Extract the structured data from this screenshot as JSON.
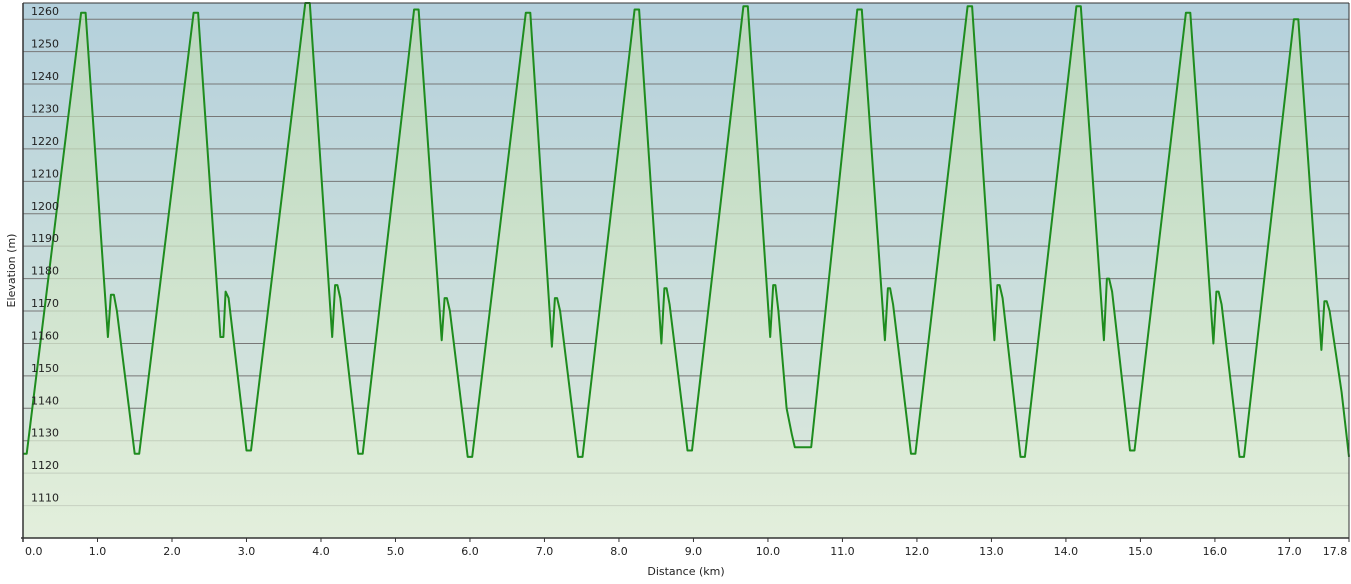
{
  "chart_data": {
    "type": "area",
    "title": "",
    "xlabel": "Distance  (km)",
    "ylabel": "Elevation (m)",
    "xlim": [
      0,
      17.8
    ],
    "ylim": [
      1100,
      1265
    ],
    "x_ticks": [
      "0.0",
      "1.0",
      "2.0",
      "3.0",
      "4.0",
      "5.0",
      "6.0",
      "7.0",
      "8.0",
      "9.0",
      "10.0",
      "11.0",
      "12.0",
      "13.0",
      "14.0",
      "15.0",
      "16.0",
      "17.0",
      "17.8"
    ],
    "y_ticks": [
      "1110",
      "1120",
      "1130",
      "1140",
      "1150",
      "1160",
      "1170",
      "1180",
      "1190",
      "1200",
      "1210",
      "1220",
      "1230",
      "1240",
      "1250",
      "1260"
    ],
    "grid": true,
    "legend": "none",
    "colors": {
      "line": "#1e8c1e",
      "fill_top": "#bcd9b4",
      "fill_bottom": "#e4f0dc",
      "bg_top": "#b4d0dc",
      "bg_bottom": "#deeadc",
      "grid": "#777777"
    },
    "series": [
      {
        "x": [
          0.0,
          0.05,
          0.78,
          0.84,
          1.14,
          1.18,
          1.22,
          1.26,
          1.5,
          1.56,
          2.29,
          2.35,
          2.65,
          2.69,
          2.72,
          2.76,
          3.0,
          3.06,
          3.79,
          3.85,
          4.15,
          4.19,
          4.22,
          4.26,
          4.5,
          4.56,
          5.25,
          5.31,
          5.62,
          5.66,
          5.69,
          5.73,
          5.97,
          6.03,
          6.75,
          6.81,
          7.1,
          7.14,
          7.17,
          7.21,
          7.45,
          7.51,
          8.21,
          8.27,
          8.57,
          8.61,
          8.64,
          8.68,
          8.92,
          8.98,
          9.67,
          9.73,
          10.03,
          10.07,
          10.1,
          10.14,
          10.25,
          10.32,
          10.36,
          10.52,
          10.58,
          11.2,
          11.26,
          11.57,
          11.61,
          11.64,
          11.68,
          11.92,
          11.98,
          12.68,
          12.74,
          13.04,
          13.08,
          13.11,
          13.15,
          13.39,
          13.45,
          14.14,
          14.2,
          14.51,
          14.55,
          14.58,
          14.62,
          14.86,
          14.92,
          15.61,
          15.67,
          15.98,
          16.02,
          16.05,
          16.09,
          16.33,
          16.39,
          17.06,
          17.12,
          17.43,
          17.47,
          17.5,
          17.54,
          17.7,
          17.8
        ],
        "y": [
          1126,
          1126,
          1262,
          1262,
          1162,
          1175,
          1175,
          1170,
          1126,
          1126,
          1262,
          1262,
          1162,
          1162,
          1176,
          1174,
          1127,
          1127,
          1265,
          1265,
          1162,
          1178,
          1178,
          1174,
          1126,
          1126,
          1263,
          1263,
          1161,
          1174,
          1174,
          1170,
          1125,
          1125,
          1262,
          1262,
          1159,
          1174,
          1174,
          1170,
          1125,
          1125,
          1263,
          1263,
          1160,
          1177,
          1177,
          1172,
          1127,
          1127,
          1264,
          1264,
          1162,
          1178,
          1178,
          1170,
          1140,
          1132,
          1128,
          1128,
          1128,
          1263,
          1263,
          1161,
          1177,
          1177,
          1172,
          1126,
          1126,
          1264,
          1264,
          1161,
          1178,
          1178,
          1174,
          1125,
          1125,
          1264,
          1264,
          1161,
          1180,
          1180,
          1176,
          1127,
          1127,
          1262,
          1262,
          1160,
          1176,
          1176,
          1172,
          1125,
          1125,
          1260,
          1260,
          1158,
          1173,
          1173,
          1170,
          1145,
          1125
        ]
      }
    ]
  }
}
